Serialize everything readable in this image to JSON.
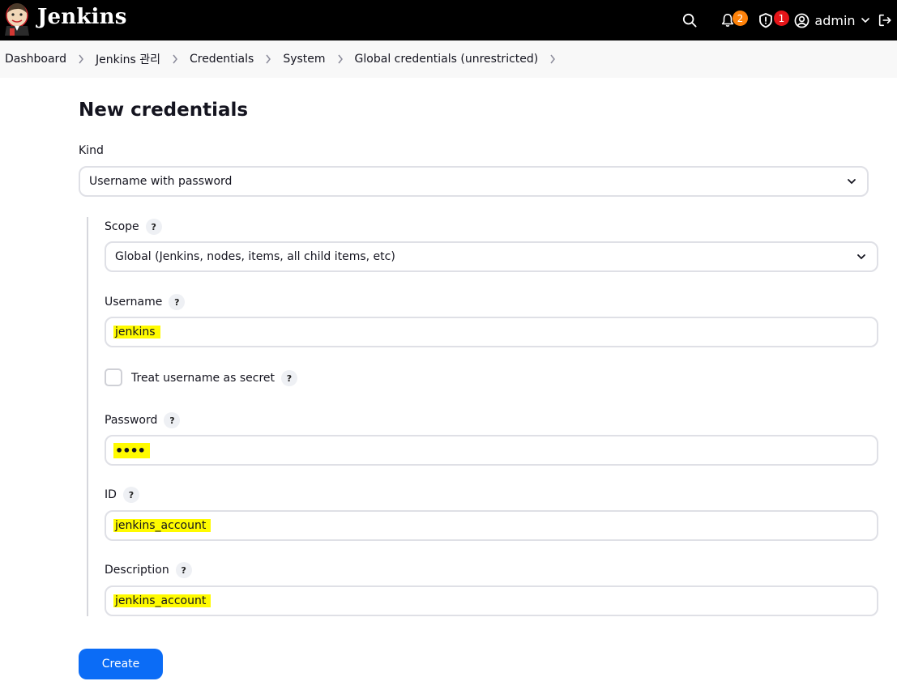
{
  "header": {
    "brand": "Jenkins",
    "notifications_count": "2",
    "security_count": "1",
    "user": "admin"
  },
  "breadcrumb": [
    "Dashboard",
    "Jenkins 관리",
    "Credentials",
    "System",
    "Global credentials (unrestricted)"
  ],
  "form": {
    "title": "New credentials",
    "kind_label": "Kind",
    "kind_value": "Username with password",
    "scope_label": "Scope",
    "scope_value": "Global (Jenkins, nodes, items, all child items, etc)",
    "username_label": "Username",
    "username_value": "jenkins",
    "treat_secret_label": "Treat username as secret",
    "password_label": "Password",
    "password_value": "••••",
    "id_label": "ID",
    "id_value": "jenkins_account",
    "description_label": "Description",
    "description_value": "jenkins_account",
    "help_mark": "?",
    "create_label": "Create"
  },
  "colors": {
    "header_bg": "#000000",
    "highlight": "#fffb00",
    "primary": "#0b6cf6",
    "badge_orange": "#fe820a",
    "badge_red": "#e61519"
  }
}
